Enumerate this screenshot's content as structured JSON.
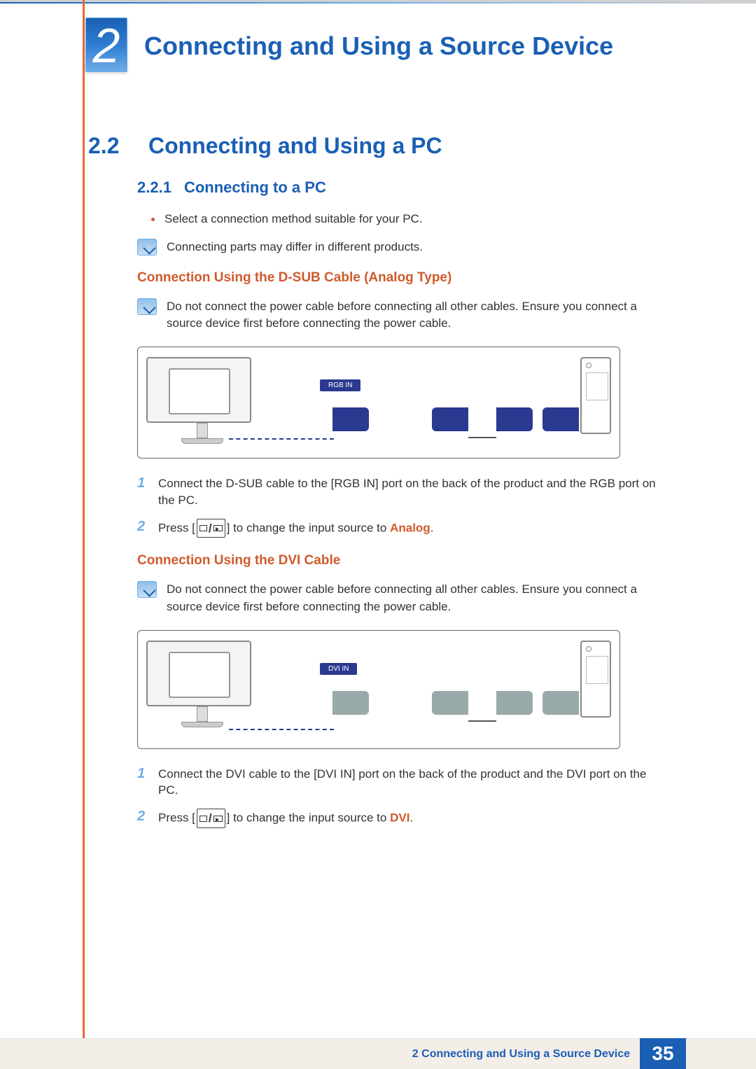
{
  "header": {
    "chapter_number": "2",
    "chapter_title": "Connecting and Using a Source Device"
  },
  "section": {
    "number": "2.2",
    "title": "Connecting and Using a PC"
  },
  "subsection": {
    "number": "2.2.1",
    "title": "Connecting to a PC",
    "bullet": "Select a connection method suitable for your PC.",
    "note": "Connecting parts may differ in different products."
  },
  "dsub": {
    "heading": "Connection Using the D-SUB Cable (Analog Type)",
    "note": "Do not connect the power cable before connecting all other cables. Ensure you connect a source device first before connecting the power cable.",
    "port_label": "RGB IN",
    "step1": "Connect the D-SUB cable to the [RGB IN] port on the back of the product and the RGB port on the PC.",
    "step2_pre": "Press [",
    "step2_post": "] to change the input source to ",
    "step2_bold": "Analog",
    "step2_end": "."
  },
  "dvi": {
    "heading": "Connection Using the DVI Cable",
    "note": "Do not connect the power cable before connecting all other cables. Ensure you connect a source device first before connecting the power cable.",
    "port_label": "DVI IN",
    "step1": "Connect the DVI cable to the [DVI IN] port on the back of the product and the DVI port on the PC.",
    "step2_pre": "Press [",
    "step2_post": "] to change the input source to ",
    "step2_bold": "DVI",
    "step2_end": "."
  },
  "footer": {
    "chapter_prefix": "2",
    "label": "Connecting and Using a Source Device",
    "page": "35"
  }
}
